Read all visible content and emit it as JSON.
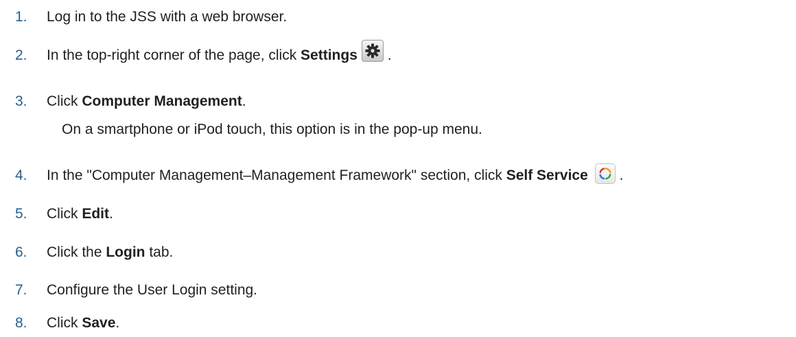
{
  "steps": [
    {
      "num": "1.",
      "pre": "Log in to the JSS with a web browser.",
      "bold": "",
      "post": ""
    },
    {
      "num": "2.",
      "pre": "In the top-right corner of the page, click ",
      "bold": "Settings",
      "post": " ."
    },
    {
      "num": "3.",
      "pre": "Click ",
      "bold": "Computer Management",
      "post": ".",
      "note": "On a smartphone or iPod touch, this option is in the pop-up menu."
    },
    {
      "num": "4.",
      "pre": "In the \"Computer Management–Management Framework\" section, click ",
      "bold": "Self Service",
      "post": " ."
    },
    {
      "num": "5.",
      "pre": "Click ",
      "bold": "Edit",
      "post": "."
    },
    {
      "num": "6.",
      "pre": "Click the ",
      "bold": "Login",
      "post": " tab."
    },
    {
      "num": "7.",
      "pre": "Configure the User Login setting.",
      "bold": "",
      "post": ""
    },
    {
      "num": "8.",
      "pre": "Click ",
      "bold": "Save",
      "post": "."
    }
  ],
  "icons": {
    "settings": "gear-icon",
    "self_service": "self-service-icon"
  }
}
